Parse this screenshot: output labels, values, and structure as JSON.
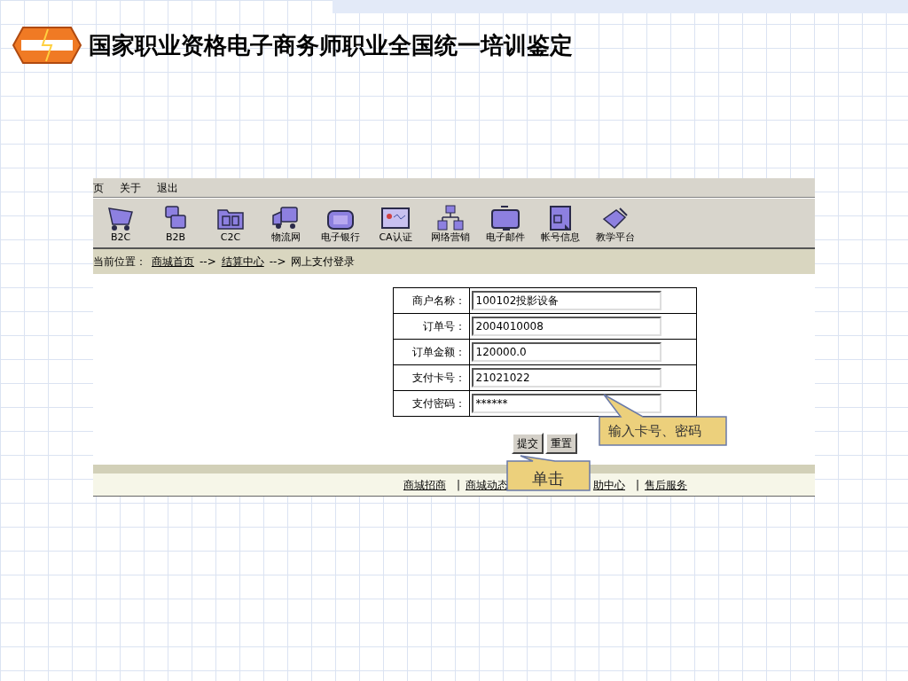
{
  "slide": {
    "title": "国家职业资格电子商务师职业全国统一培训鉴定"
  },
  "menu": [
    "页",
    "关于",
    "退出"
  ],
  "toolbar": [
    {
      "label": "B2C"
    },
    {
      "label": "B2B"
    },
    {
      "label": "C2C"
    },
    {
      "label": "物流网"
    },
    {
      "label": "电子银行"
    },
    {
      "label": "CA认证"
    },
    {
      "label": "网络营销"
    },
    {
      "label": "电子邮件"
    },
    {
      "label": "帐号信息"
    },
    {
      "label": "教学平台"
    }
  ],
  "breadcrumb": {
    "prefix": "当前位置：",
    "links": [
      "商城首页",
      "结算中心"
    ],
    "separator": "-->",
    "current": "网上支付登录"
  },
  "form": {
    "rows": [
      {
        "label": "商户名称：",
        "value": "100102投影设备"
      },
      {
        "label": "订单号：",
        "value": "2004010008"
      },
      {
        "label": "订单金额：",
        "value": "120000.0"
      },
      {
        "label": "支付卡号：",
        "value": "21021022"
      },
      {
        "label": "支付密码：",
        "value": "******"
      }
    ],
    "buttons": [
      "提交",
      "重置"
    ]
  },
  "footer": {
    "links": [
      "商城招商",
      "商城动态",
      "助中心",
      "售后服务"
    ],
    "separator": "|"
  },
  "callouts": [
    "输入卡号、密码",
    "单击"
  ]
}
